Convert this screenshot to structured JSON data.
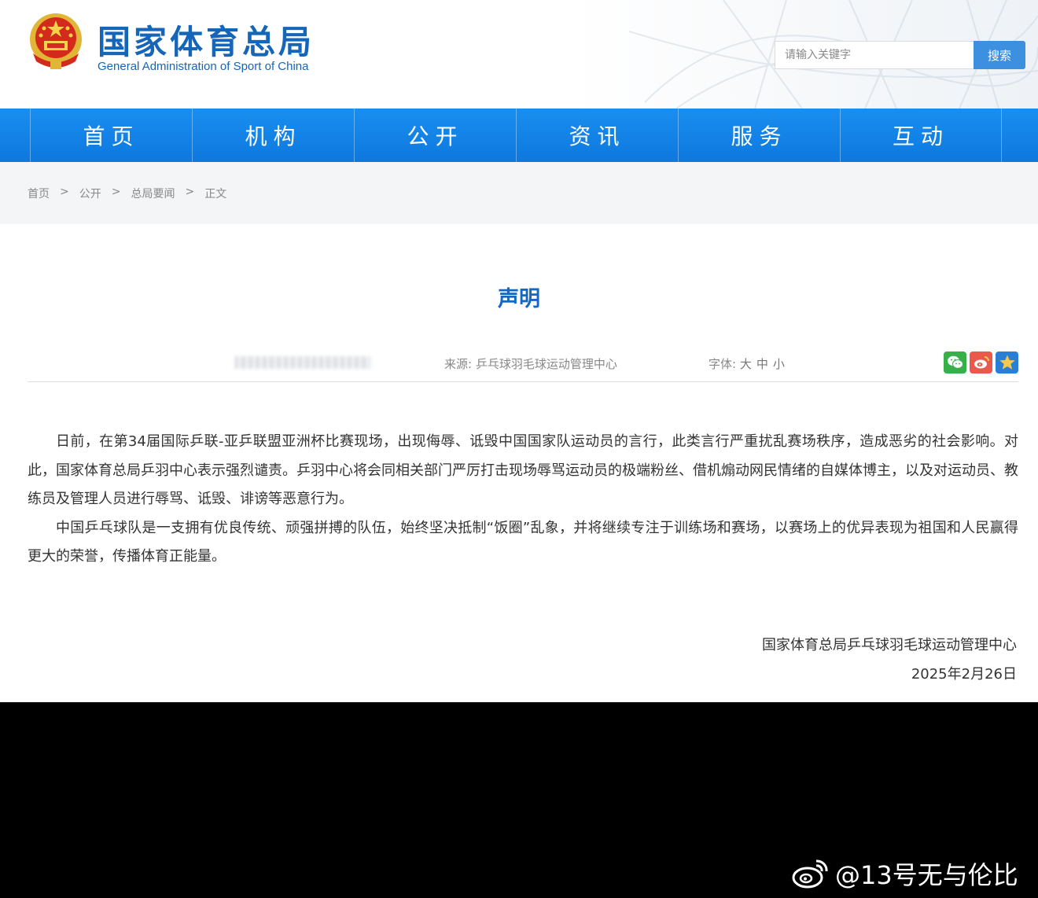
{
  "header": {
    "site_title": "国家体育总局",
    "site_subtitle": "General Administration of Sport of China",
    "search_placeholder": "请输入关键字",
    "search_button": "搜索"
  },
  "nav": {
    "items": [
      "首页",
      "机构",
      "公开",
      "资讯",
      "服务",
      "互动"
    ]
  },
  "breadcrumb": {
    "items": [
      "首页",
      "公开",
      "总局要闻",
      "正文"
    ],
    "separator": ">"
  },
  "article": {
    "title": "声明",
    "meta": {
      "source_label": "来源: ",
      "source_value": "乒乓球羽毛球运动管理中心",
      "font_label": "字体: ",
      "font_sizes": [
        "大",
        "中",
        "小"
      ]
    },
    "paragraphs": [
      "日前，在第34届国际乒联-亚乒联盟亚洲杯比赛现场，出现侮辱、诋毁中国国家队运动员的言行，此类言行严重扰乱赛场秩序，造成恶劣的社会影响。对此，国家体育总局乒羽中心表示强烈谴责。乒羽中心将会同相关部门严厉打击现场辱骂运动员的极端粉丝、借机煽动网民情绪的自媒体博主，以及对运动员、教练员及管理人员进行辱骂、诋毁、诽谤等恶意行为。",
      "中国乒乓球队是一支拥有优良传统、顽强拼搏的队伍，始终坚决抵制“饭圈”乱象，并将继续专注于训练场和赛场，以赛场上的优异表现为祖国和人民赢得更大的荣誉，传播体育正能量。"
    ],
    "signature": {
      "org": "国家体育总局乒乓球羽毛球运动管理中心",
      "date": "2025年2月26日"
    }
  },
  "watermark": {
    "text": "@13号无与伦比"
  },
  "colors": {
    "brand_blue": "#1565b8",
    "nav_blue": "#0d78de",
    "title_blue": "#1468bf",
    "wechat_green": "#37b04a",
    "weibo_red": "#ea5a4c"
  },
  "icons": [
    "national-emblem-icon",
    "wechat-icon",
    "weibo-icon",
    "star-icon",
    "weibo-logo-icon"
  ]
}
